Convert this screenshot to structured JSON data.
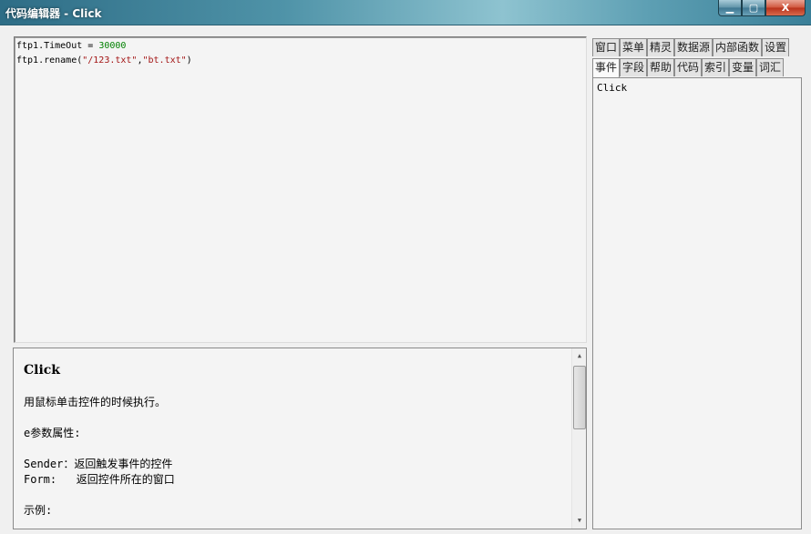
{
  "window": {
    "title": "代码编辑器 - Click",
    "buttons": {
      "minimize": "▁",
      "maximize": "▢",
      "close": "X"
    }
  },
  "editor": {
    "line1": {
      "code": "ftp1.TimeOut = ",
      "number": "30000"
    },
    "line2": {
      "code1": "ftp1.rename(",
      "str1": "\"/123.txt\"",
      "comma": ",",
      "str2": "\"bt.txt\"",
      "close": ")"
    }
  },
  "help": {
    "title": "Click",
    "description": "用鼠标单击控件的时候执行。",
    "param_header": "e参数属性:",
    "params": [
      "Sender：返回触发事件的控件",
      "Form:   返回控件所在的窗口"
    ],
    "example_header": "示例:"
  },
  "tabs": {
    "row1": [
      "窗口",
      "菜单",
      "精灵",
      "数据源",
      "内部函数",
      "设置"
    ],
    "row2": [
      "事件",
      "字段",
      "帮助",
      "代码",
      "索引",
      "变量",
      "词汇"
    ],
    "active": "事件"
  },
  "events": {
    "items": [
      "Click"
    ]
  },
  "colors": {
    "number": "#008000",
    "string": "#a31515"
  },
  "scrollbar": {
    "up_arrow": "▲",
    "down_arrow": "▼"
  }
}
